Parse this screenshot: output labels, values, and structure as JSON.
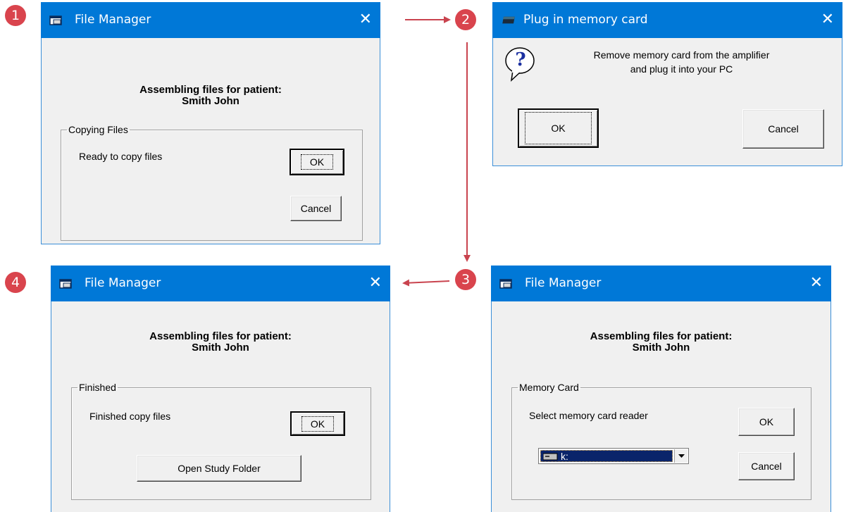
{
  "steps": [
    "1",
    "2",
    "3",
    "4"
  ],
  "dialog1": {
    "title": "File Manager",
    "close": "✕",
    "heading_line1": "Assembling files for patient:",
    "heading_line2": "Smith John",
    "group_label": "Copying Files",
    "status": "Ready to copy files",
    "ok_label": "OK",
    "cancel_label": "Cancel"
  },
  "dialog2": {
    "title": "Plug in memory card",
    "close": "✕",
    "message_line1": "Remove memory card from the amplifier",
    "message_line2": "and plug it into your PC",
    "icon_glyph": "?",
    "ok_label": "OK",
    "cancel_label": "Cancel"
  },
  "dialog3": {
    "title": "File Manager",
    "close": "✕",
    "heading_line1": "Assembling files for patient:",
    "heading_line2": "Smith John",
    "group_label": "Memory Card",
    "status": "Select memory card reader",
    "select_value": "k:",
    "ok_label": "OK",
    "cancel_label": "Cancel"
  },
  "dialog4": {
    "title": "File Manager",
    "close": "✕",
    "heading_line1": "Assembling files for patient:",
    "heading_line2": "Smith John",
    "group_label": "Finished",
    "status": "Finished copy files",
    "ok_label": "OK",
    "open_folder_label": "Open Study Folder"
  },
  "colors": {
    "titlebar": "#0078d7",
    "step_badge": "#d9444d",
    "arrow": "#c9434e",
    "selection": "#0a246a"
  }
}
